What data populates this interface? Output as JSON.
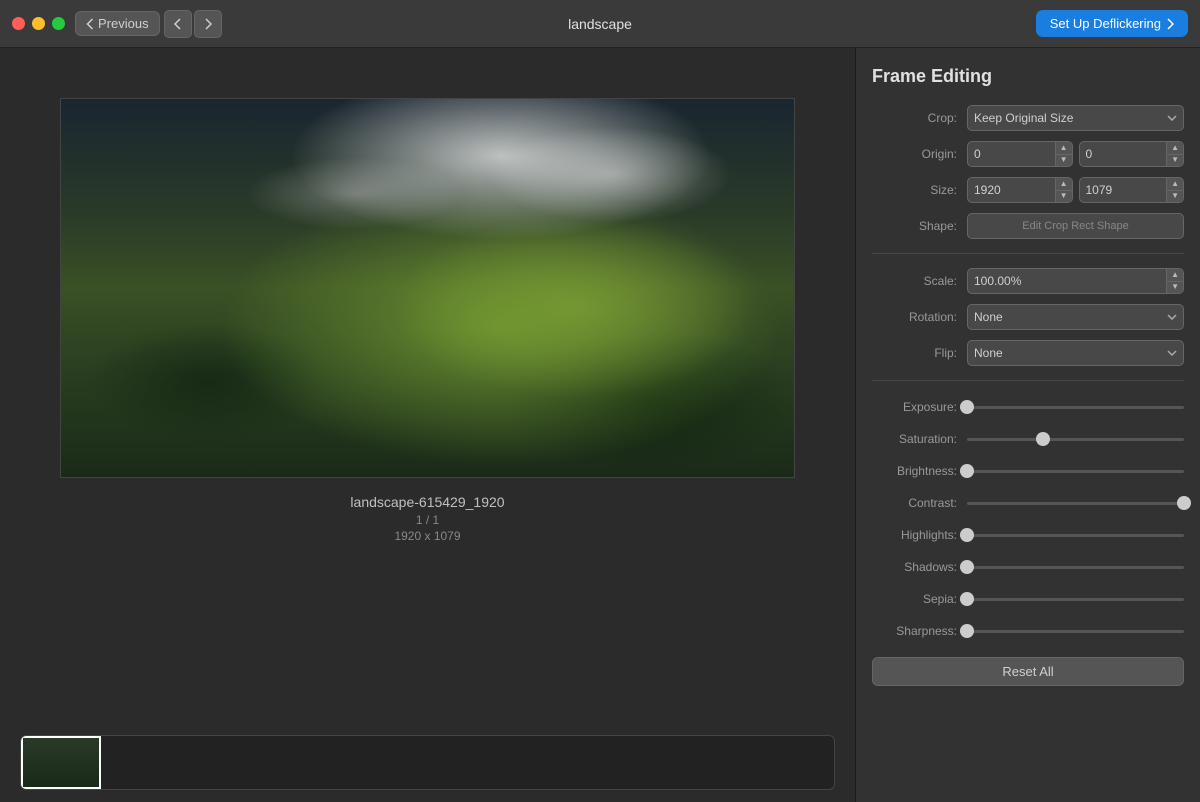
{
  "titlebar": {
    "title": "landscape",
    "previous_label": "Previous",
    "deflicker_label": "Set Up Deflickering"
  },
  "left": {
    "filename": "landscape-615429_1920",
    "counter": "1 / 1",
    "dimensions": "1920 x 1079"
  },
  "right": {
    "section_title": "Frame Editing",
    "crop": {
      "label": "Crop:",
      "value": "Keep Original Size"
    },
    "origin": {
      "label": "Origin:",
      "x": "0",
      "y": "0"
    },
    "size": {
      "label": "Size:",
      "w": "1920",
      "h": "1079"
    },
    "shape": {
      "label": "Shape:",
      "button": "Edit Crop Rect Shape"
    },
    "scale": {
      "label": "Scale:",
      "value": "100.00%"
    },
    "rotation": {
      "label": "Rotation:",
      "value": "None"
    },
    "flip": {
      "label": "Flip:",
      "value": "None"
    },
    "sliders": [
      {
        "label": "Exposure:",
        "position": 0
      },
      {
        "label": "Saturation:",
        "position": 35
      },
      {
        "label": "Brightness:",
        "position": 0
      },
      {
        "label": "Contrast:",
        "position": 100
      },
      {
        "label": "Highlights:",
        "position": 0
      },
      {
        "label": "Shadows:",
        "position": 0
      },
      {
        "label": "Sepia:",
        "position": 0
      },
      {
        "label": "Sharpness:",
        "position": 0
      }
    ],
    "reset_label": "Reset All"
  }
}
